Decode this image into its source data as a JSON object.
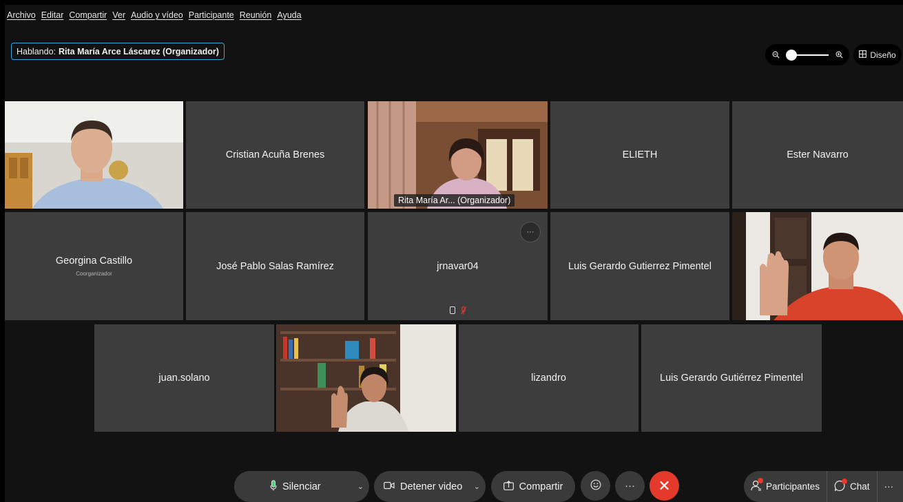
{
  "menu": [
    "Archivo",
    "Editar",
    "Compartir",
    "Ver",
    "Audio y vídeo",
    "Participante",
    "Reunión",
    "Ayuda"
  ],
  "speaking": {
    "prefix": "Hablando:",
    "name": "Rita María Arce Láscarez (Organizador)"
  },
  "zoom": {
    "level": 0.0,
    "zoom_out_icon": "zoom-out-icon",
    "zoom_in_icon": "zoom-in-icon"
  },
  "layout_button": {
    "label": "Diseño",
    "icon": "grid-icon"
  },
  "participants": [
    {
      "name": "",
      "has_video": true,
      "scene": "man-white-shirt"
    },
    {
      "name": "Cristian Acuña Brenes"
    },
    {
      "name": "",
      "has_video": true,
      "active_speaker": true,
      "caption": "Rita María Ar...  (Organizador)"
    },
    {
      "name": "ELIETH"
    },
    {
      "name": "Ester Navarro"
    },
    {
      "name": "Georgina Castillo",
      "role": "Coorganizador"
    },
    {
      "name": "José Pablo Salas Ramírez"
    },
    {
      "name": "jrnavar04",
      "more_label": "···",
      "muted": true
    },
    {
      "name": "Luis Gerardo Gutierrez Pimentel"
    },
    {
      "name": "",
      "has_video": true,
      "scene": "man-raised-hand"
    },
    {
      "name": "juan.solano"
    },
    {
      "name": "",
      "has_video": true,
      "scene": "woman-raised-hand"
    },
    {
      "name": "lizandro"
    },
    {
      "name": "Luis Gerardo Gutiérrez Pimentel"
    }
  ],
  "controls": {
    "mute": "Silenciar",
    "video": "Detener video",
    "share": "Compartir",
    "more": "···",
    "end_icon": "✕",
    "participants": "Participantes",
    "chat": "Chat",
    "overflow": "···"
  },
  "colors": {
    "accent": "#33b1e8",
    "end_call": "#e5392b",
    "tile": "#3d3d3d",
    "background": "#121212"
  }
}
